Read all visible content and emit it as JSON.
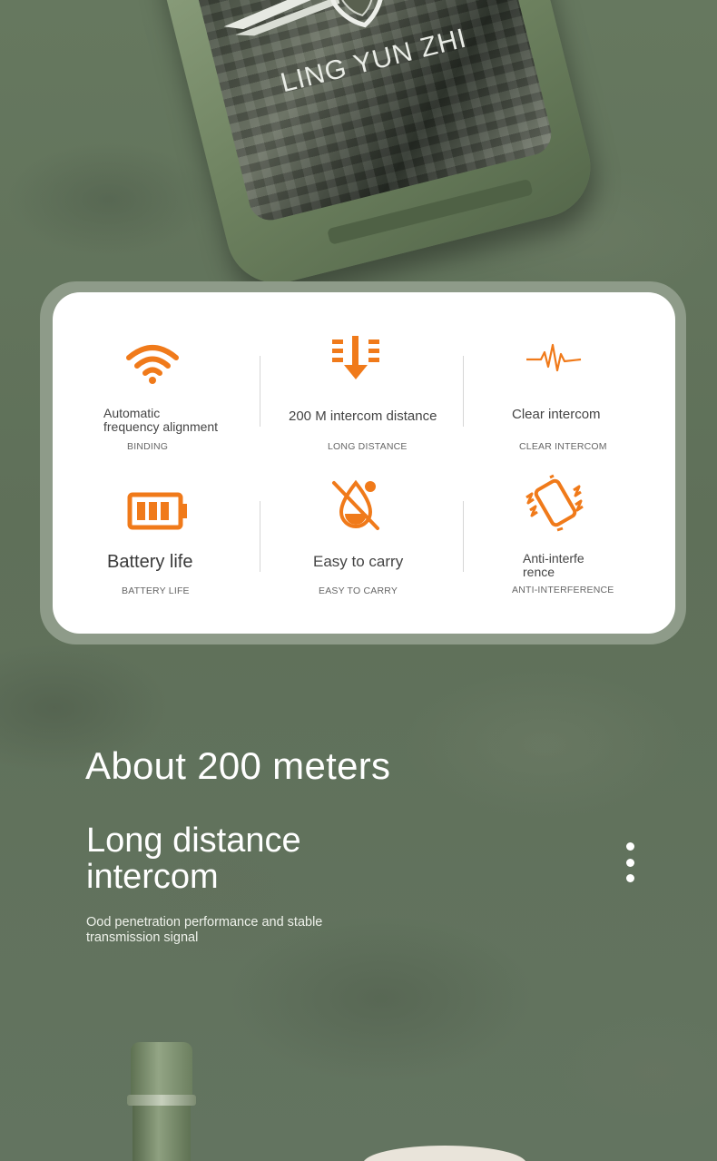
{
  "device": {
    "brand": "LING YUN ZHI",
    "logo_icon": "shield-wings-logo-icon"
  },
  "colors": {
    "accent_orange": "#f07a1a",
    "background_camo": "#5f7059",
    "card_white": "#ffffff"
  },
  "features": [
    {
      "icon": "wifi-icon",
      "title": "Automatic frequency alignment",
      "title_line1": "Automatic",
      "title_line2": "frequency alignment",
      "subtitle": "BINDING"
    },
    {
      "icon": "distance-arrow-icon",
      "title": "200 M intercom distance",
      "subtitle": "LONG DISTANCE"
    },
    {
      "icon": "sound-wave-icon",
      "title": "Clear intercom",
      "subtitle": "CLEAR INTERCOM"
    },
    {
      "icon": "battery-icon",
      "title": "Battery life",
      "subtitle": "BATTERY LIFE"
    },
    {
      "icon": "no-water-drop-icon",
      "title": "Easy to carry",
      "subtitle": "EASY TO CARRY"
    },
    {
      "icon": "vibrating-phone-icon",
      "title": "Anti-interference",
      "title_line1": "Anti-interfe",
      "title_line2": "rence",
      "subtitle": "ANTI-INTERFERENCE"
    }
  ],
  "section": {
    "headline": "About 200 meters",
    "subhead_line1": "Long distance",
    "subhead_line2": "intercom",
    "desc_line1": "Ood penetration performance and stable",
    "desc_line2": "transmission signal"
  }
}
